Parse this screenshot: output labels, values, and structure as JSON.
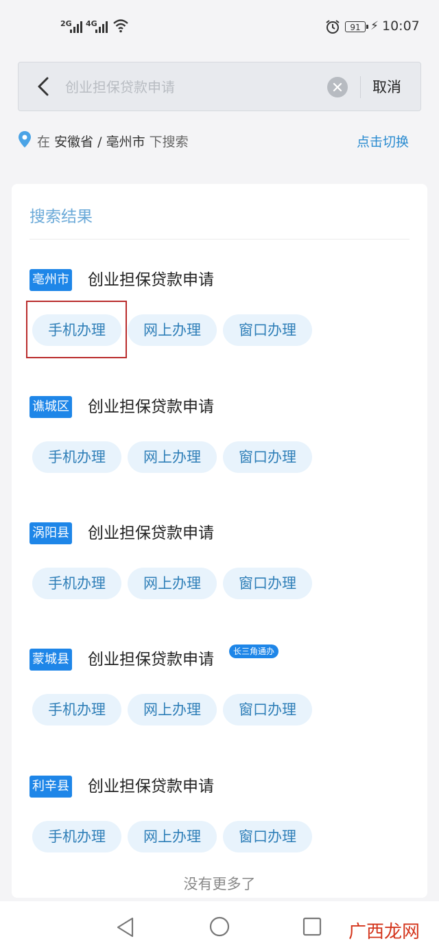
{
  "status_bar": {
    "signal_1": "2G",
    "signal_2": "4G",
    "battery": "91",
    "time": "10:07"
  },
  "search": {
    "placeholder": "创业担保贷款申请",
    "cancel_label": "取消"
  },
  "location": {
    "prefix": "在",
    "province": "安徽省",
    "separator": "/",
    "city": "亳州市",
    "suffix": "下搜索",
    "switch_label": "点击切换"
  },
  "results": {
    "title": "搜索结果",
    "items": [
      {
        "region": "亳州市",
        "name": "创业担保贷款申请",
        "tag": "",
        "buttons": [
          "手机办理",
          "网上办理",
          "窗口办理"
        ]
      },
      {
        "region": "谯城区",
        "name": "创业担保贷款申请",
        "tag": "",
        "buttons": [
          "手机办理",
          "网上办理",
          "窗口办理"
        ]
      },
      {
        "region": "涡阳县",
        "name": "创业担保贷款申请",
        "tag": "",
        "buttons": [
          "手机办理",
          "网上办理",
          "窗口办理"
        ]
      },
      {
        "region": "蒙城县",
        "name": "创业担保贷款申请",
        "tag": "长三角通办",
        "buttons": [
          "手机办理",
          "网上办理",
          "窗口办理"
        ]
      },
      {
        "region": "利辛县",
        "name": "创业担保贷款申请",
        "tag": "",
        "buttons": [
          "手机办理",
          "网上办理",
          "窗口办理"
        ]
      }
    ],
    "no_more": "没有更多了"
  },
  "watermark": "广西龙网",
  "colors": {
    "accent": "#1e86e8",
    "button_bg": "#e8f3fc",
    "button_text": "#2f7fb8",
    "highlight": "#b92b2b"
  },
  "icons": [
    "signal-icon",
    "wifi-icon",
    "alarm-icon",
    "battery-icon",
    "back-arrow-icon",
    "clear-icon",
    "location-pin-icon",
    "nav-back-icon",
    "nav-home-icon",
    "nav-recent-icon"
  ]
}
